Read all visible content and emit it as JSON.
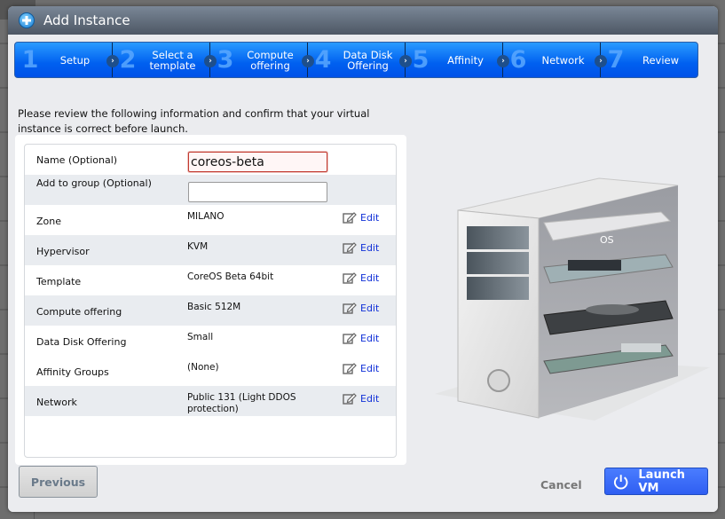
{
  "window": {
    "title": "Add Instance",
    "title_icon": "plus-circle-icon"
  },
  "wizard": {
    "steps": [
      {
        "number": "1",
        "label": "Setup"
      },
      {
        "number": "2",
        "label": "Select a template"
      },
      {
        "number": "3",
        "label": "Compute offering"
      },
      {
        "number": "4",
        "label": "Data Disk Offering"
      },
      {
        "number": "5",
        "label": "Affinity"
      },
      {
        "number": "6",
        "label": "Network"
      },
      {
        "number": "7",
        "label": "Review"
      }
    ],
    "active_step": "7",
    "accent_color": "#0a6cff"
  },
  "review": {
    "intro": "Please review the following information and confirm that your virtual instance is correct before launch.",
    "name_field": {
      "label": "Name (Optional)",
      "value": "coreos-beta",
      "state": "error"
    },
    "group_field": {
      "label": "Add to group (Optional)",
      "value": ""
    },
    "edit_label": "Edit",
    "rows": [
      {
        "label": "Zone",
        "value": "MILANO"
      },
      {
        "label": "Hypervisor",
        "value": "KVM"
      },
      {
        "label": "Template",
        "value": "CoreOS Beta 64bit"
      },
      {
        "label": "Compute offering",
        "value": "Basic 512M"
      },
      {
        "label": "Data Disk Offering",
        "value": "Small"
      },
      {
        "label": "Affinity Groups",
        "value": "(None)"
      },
      {
        "label": "Network",
        "value": "Public 131 (Light DDOS protection)"
      }
    ]
  },
  "illustration": {
    "os_label": "OS"
  },
  "footer": {
    "previous_label": "Previous",
    "cancel_label": "Cancel",
    "launch_label": "Launch VM",
    "launch_color": "#3a69f8"
  }
}
